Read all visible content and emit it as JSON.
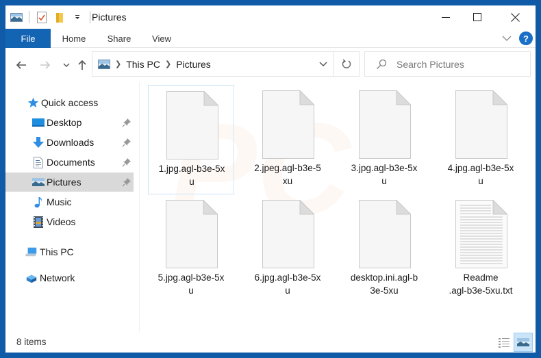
{
  "window": {
    "title": "Pictures",
    "controls": {
      "minimize": "minimize",
      "maximize": "maximize",
      "close": "close"
    }
  },
  "quick_access_toolbar": {
    "icons": [
      "pictures-icon",
      "properties-icon",
      "new-folder-icon",
      "customize-dropdown-icon"
    ]
  },
  "ribbon": {
    "tabs": [
      {
        "label": "File",
        "active": true
      },
      {
        "label": "Home"
      },
      {
        "label": "Share"
      },
      {
        "label": "View"
      }
    ],
    "help_label": "?"
  },
  "navigation": {
    "back": "←",
    "forward": "→",
    "recent": "⌄",
    "up": "↑",
    "breadcrumb": [
      "This PC",
      "Pictures"
    ],
    "refresh": "↻",
    "search": {
      "placeholder": "Search Pictures",
      "value": ""
    }
  },
  "sidebar": {
    "items": [
      {
        "label": "Quick access",
        "icon": "star-icon",
        "level": 0
      },
      {
        "label": "Desktop",
        "icon": "desktop-icon",
        "level": 1,
        "pinned": true
      },
      {
        "label": "Downloads",
        "icon": "downloads-icon",
        "level": 1,
        "pinned": true
      },
      {
        "label": "Documents",
        "icon": "documents-icon",
        "level": 1,
        "pinned": true
      },
      {
        "label": "Pictures",
        "icon": "pictures-icon",
        "level": 1,
        "pinned": true,
        "selected": true
      },
      {
        "label": "Music",
        "icon": "music-icon",
        "level": 1
      },
      {
        "label": "Videos",
        "icon": "videos-icon",
        "level": 1
      },
      {
        "label": "This PC",
        "icon": "this-pc-icon",
        "level": 0
      },
      {
        "label": "Network",
        "icon": "network-icon",
        "level": 0
      }
    ]
  },
  "files": [
    {
      "name": "1.jpg.agl-b3e-5x\nu",
      "type": "blank",
      "selected": true
    },
    {
      "name": "2.jpeg.agl-b3e-5\nxu",
      "type": "blank"
    },
    {
      "name": "3.jpg.agl-b3e-5x\nu",
      "type": "blank"
    },
    {
      "name": "4.jpg.agl-b3e-5x\nu",
      "type": "blank"
    },
    {
      "name": "5.jpg.agl-b3e-5x\nu",
      "type": "blank"
    },
    {
      "name": "6.jpg.agl-b3e-5x\nu",
      "type": "blank"
    },
    {
      "name": "desktop.ini.agl-b\n3e-5xu",
      "type": "blank"
    },
    {
      "name": "Readme\n.agl-b3e-5xu.txt",
      "type": "text"
    }
  ],
  "status": {
    "item_count": "8 items",
    "views": [
      "details-view",
      "large-icons-view"
    ],
    "active_view": "large-icons-view"
  },
  "colors": {
    "accent": "#1464b4",
    "window_border": "#0f5ba8",
    "selection": "#cce4f7",
    "sidebar_selected": "#d9d9d9"
  }
}
